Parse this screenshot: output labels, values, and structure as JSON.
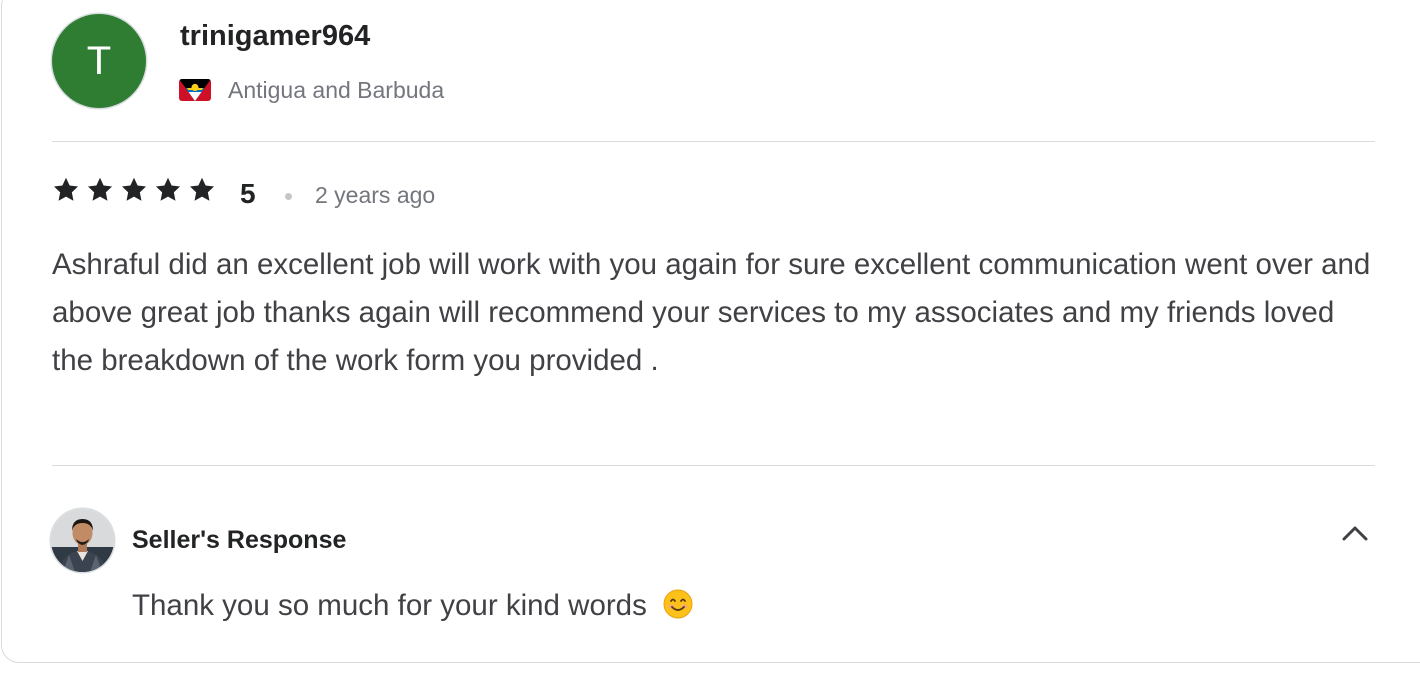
{
  "reviewer": {
    "initial": "T",
    "avatar_color": "#2e7d32",
    "username": "trinigamer964",
    "country": "Antigua and Barbuda",
    "flag_icon": "antigua-and-barbuda-flag-icon"
  },
  "review": {
    "rating_value": "5",
    "stars": 5,
    "time_ago": "2 years ago",
    "text": "Ashraful did an excellent job will work with you again for sure excellent communication went over and above great job thanks again will recommend your services to my associates and my friends loved the breakdown of the work form you provided ."
  },
  "seller_response": {
    "title": "Seller's Response",
    "text": "Thank you so much for your kind words",
    "emoji_icon": "smiling-face-icon",
    "toggle_icon": "chevron-up-icon"
  },
  "colors": {
    "star": "#222325",
    "border": "#dadbdd",
    "muted_text": "#74767e"
  }
}
